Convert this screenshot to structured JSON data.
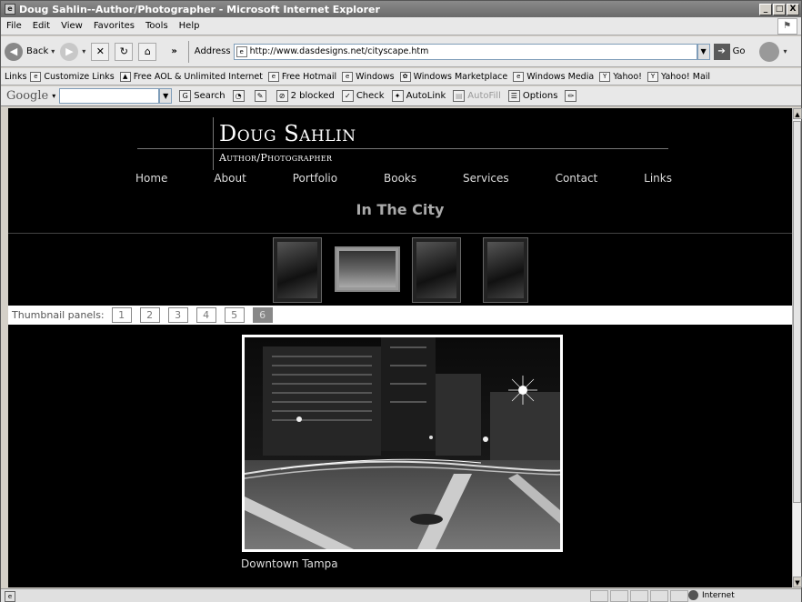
{
  "window": {
    "title": "Doug Sahlin--Author/Photographer - Microsoft Internet Explorer",
    "controls": [
      "_",
      "□",
      "X"
    ]
  },
  "menu": {
    "items": [
      "File",
      "Edit",
      "View",
      "Favorites",
      "Tools",
      "Help"
    ]
  },
  "toolbar": {
    "back_label": "Back",
    "chevron": "»",
    "address_label": "Address",
    "url": "http://www.dasdesigns.net/cityscape.htm",
    "go_label": "Go"
  },
  "links_bar": {
    "label": "Links",
    "items": [
      "Customize Links",
      "Free AOL & Unlimited Internet",
      "Free Hotmail",
      "Windows",
      "Windows Marketplace",
      "Windows Media",
      "Yahoo!",
      "Yahoo! Mail"
    ]
  },
  "google_bar": {
    "logo": "Google",
    "search_label": "Search",
    "blocked_label": "2 blocked",
    "check_label": "Check",
    "autolink_label": "AutoLink",
    "autofill_label": "AutoFill",
    "options_label": "Options"
  },
  "site": {
    "name": "Doug Sahlin",
    "tagline": "Author/Photographer",
    "nav": [
      "Home",
      "About",
      "Portfolio",
      "Books",
      "Services",
      "Contact",
      "Links"
    ],
    "heading": "In The City"
  },
  "thumbnails": {
    "panel_label": "Thumbnail panels:",
    "panels": [
      "1",
      "2",
      "3",
      "4",
      "5",
      "6"
    ],
    "active_panel": "6"
  },
  "photo": {
    "caption": "Downtown Tampa"
  },
  "status": {
    "zone": "Internet"
  }
}
